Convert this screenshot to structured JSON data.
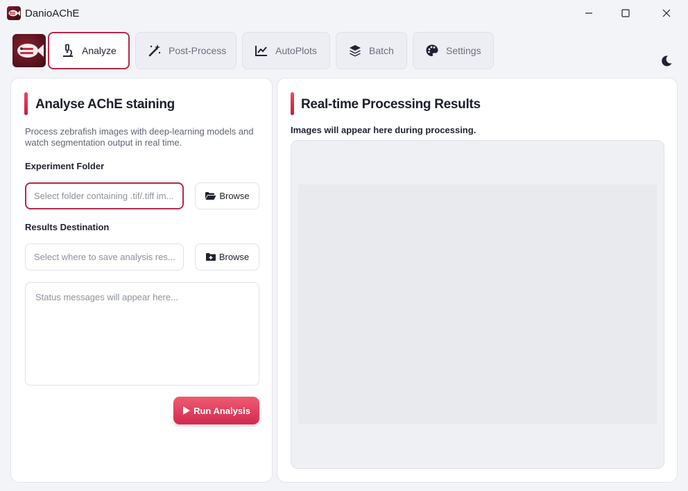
{
  "window": {
    "title": "DanioAChE"
  },
  "tabs": [
    {
      "label": "Analyze",
      "icon": "microscope-icon",
      "active": true
    },
    {
      "label": "Post-Process",
      "icon": "magic-wand-icon",
      "active": false
    },
    {
      "label": "AutoPlots",
      "icon": "line-chart-icon",
      "active": false
    },
    {
      "label": "Batch",
      "icon": "layers-icon",
      "active": false
    },
    {
      "label": "Settings",
      "icon": "palette-icon",
      "active": false
    }
  ],
  "left_panel": {
    "title": "Analyse AChE staining",
    "description": "Process zebrafish images with deep-learning models and watch segmentation output in real time.",
    "experiment_folder": {
      "label": "Experiment Folder",
      "value": "",
      "placeholder": "Select folder containing .tif/.tiff im...",
      "browse_label": "Browse"
    },
    "results_destination": {
      "label": "Results Destination",
      "value": "",
      "placeholder": "Select where to save analysis res...",
      "browse_label": "Browse"
    },
    "status": {
      "value": "",
      "placeholder": "Status messages will appear here..."
    },
    "run_label": "Run Analysis"
  },
  "right_panel": {
    "title": "Real-time Processing Results",
    "subtitle": "Images will appear here during processing."
  },
  "colors": {
    "accent": "#c01d45",
    "accent_light": "#ef5b72",
    "background": "#f3f4f8",
    "panel": "#ffffff"
  }
}
